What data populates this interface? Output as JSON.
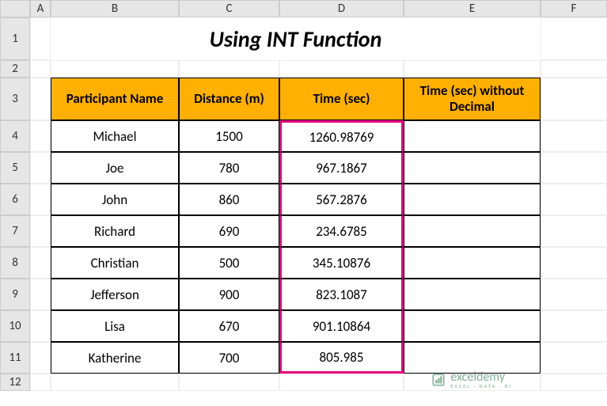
{
  "columns": [
    "A",
    "B",
    "C",
    "D",
    "E",
    "F"
  ],
  "rows": [
    "1",
    "2",
    "3",
    "4",
    "5",
    "6",
    "7",
    "8",
    "9",
    "10",
    "11",
    "12"
  ],
  "title": "Using INT Function",
  "headers": {
    "name": "Participant Name",
    "dist": "Distance (m)",
    "time": "Time (sec)",
    "noDec": "Time (sec) without Decimal"
  },
  "data": [
    {
      "name": "Michael",
      "dist": "1500",
      "time": "1260.98769",
      "noDec": ""
    },
    {
      "name": "Joe",
      "dist": "780",
      "time": "967.1867",
      "noDec": ""
    },
    {
      "name": "John",
      "dist": "860",
      "time": "567.2876",
      "noDec": ""
    },
    {
      "name": "Richard",
      "dist": "690",
      "time": "234.6785",
      "noDec": ""
    },
    {
      "name": "Christian",
      "dist": "500",
      "time": "345.10876",
      "noDec": ""
    },
    {
      "name": "Jefferson",
      "dist": "900",
      "time": "823.1087",
      "noDec": ""
    },
    {
      "name": "Lisa",
      "dist": "670",
      "time": "901.10864",
      "noDec": ""
    },
    {
      "name": "Katherine",
      "dist": "700",
      "time": "805.985",
      "noDec": ""
    }
  ],
  "watermark": {
    "main": "exceldemy",
    "sub": "EXCEL · DATA · BI"
  }
}
